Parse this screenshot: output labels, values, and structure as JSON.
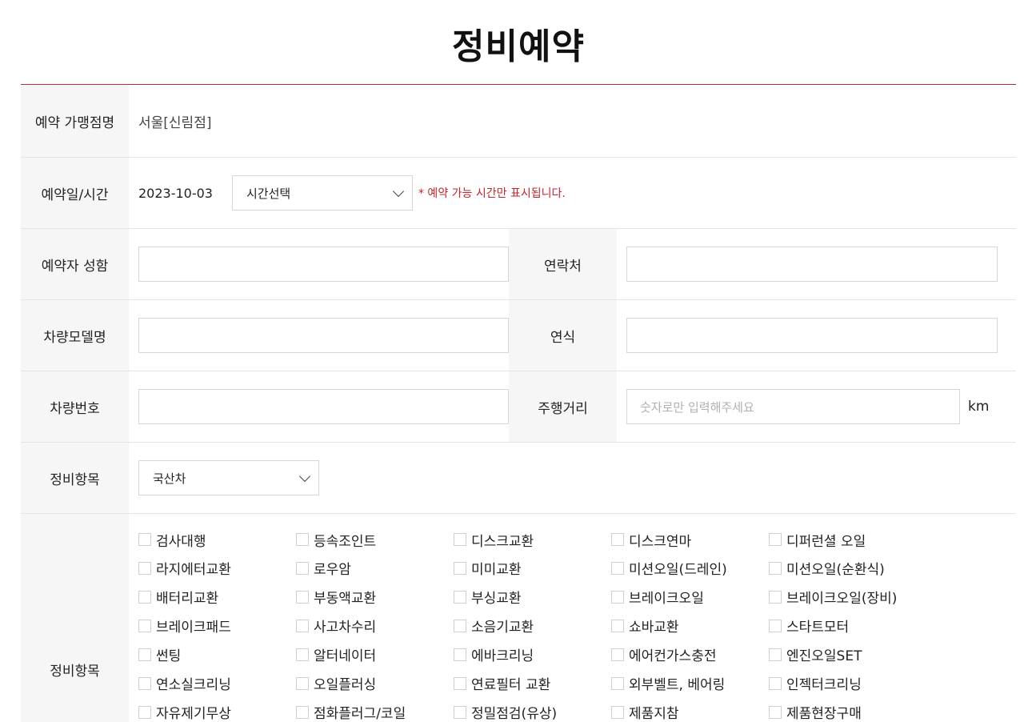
{
  "title": "정비예약",
  "shop": {
    "label": "예약 가맹점명",
    "value": "서울[신림점]"
  },
  "date_time": {
    "label": "예약일/시간",
    "date": "2023-10-03",
    "time_select": "시간선택",
    "notice": "* 예약 가능 시간만 표시됩니다."
  },
  "name": {
    "label": "예약자 성함",
    "value": ""
  },
  "contact": {
    "label": "연락처",
    "value": ""
  },
  "model": {
    "label": "차량모델명",
    "value": ""
  },
  "year": {
    "label": "연식",
    "value": ""
  },
  "plate": {
    "label": "차량번호",
    "value": ""
  },
  "mileage": {
    "label": "주행거리",
    "placeholder": "숫자로만 입력해주세요",
    "unit": "km"
  },
  "category": {
    "label": "정비항목",
    "selected": "국산차"
  },
  "services": {
    "label": "정비항목",
    "items": [
      "검사대행",
      "등속조인트",
      "디스크교환",
      "디스크연마",
      "디퍼런셜 오일",
      "라지에터교환",
      "로우암",
      "미미교환",
      "미션오일(드레인)",
      "미션오일(순환식)",
      "배터리교환",
      "부동액교환",
      "부싱교환",
      "브레이크오일",
      "브레이크오일(장비)",
      "브레이크패드",
      "사고차수리",
      "소음기교환",
      "쇼바교환",
      "스타트모터",
      "썬팅",
      "알터네이터",
      "에바크리닝",
      "에어컨가스충전",
      "엔진오일SET",
      "연소실크리닝",
      "오일플러싱",
      "연료필터 교환",
      "외부벨트, 베어링",
      "인젝터크리닝",
      "자유제기무상",
      "점화플러그/코일",
      "정밀점검(유상)",
      "제품지참",
      "제품현장구매"
    ]
  }
}
